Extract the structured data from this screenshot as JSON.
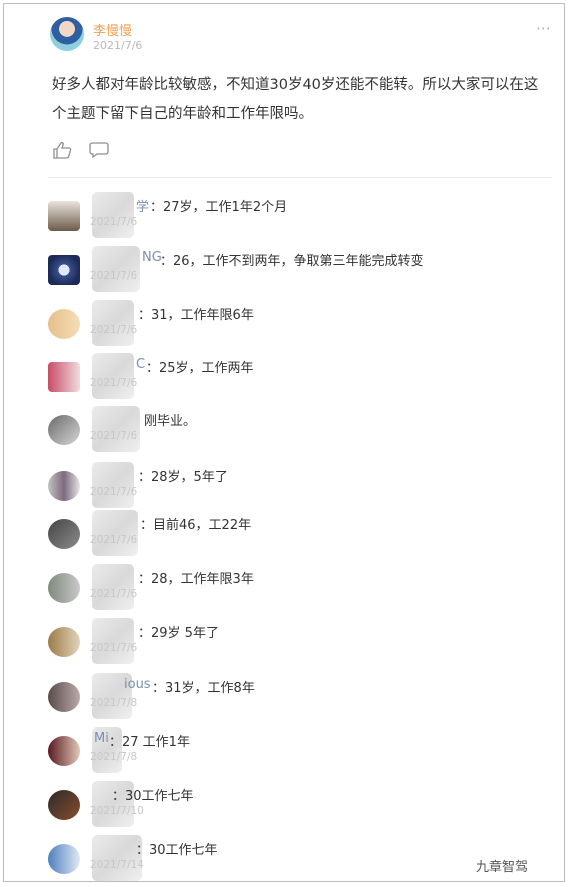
{
  "post": {
    "author": "李慢慢",
    "date": "2021/7/6",
    "content": "好多人都对年龄比较敏感，不知道30岁40岁还能不能转。所以大家可以在这个主题下留下自己的年龄和工作年限吗。",
    "more_icon": "more-icon",
    "like_icon": "like-icon",
    "comment_icon": "comment-icon"
  },
  "comments": [
    {
      "name": "学",
      "text": "：27岁，工作1年2个月",
      "date": "2021/7/6"
    },
    {
      "name": "NG",
      "text": "：26，工作不到两年，争取第三年能完成转变",
      "date": "2021/7/6"
    },
    {
      "name": "",
      "text": "：31，工作年限6年",
      "date": "2021/7/6"
    },
    {
      "name": "C",
      "text": "：25岁，工作两年",
      "date": "2021/7/6"
    },
    {
      "name": "",
      "text": "刚毕业。",
      "date": "2021/7/6"
    },
    {
      "name": "",
      "text": "：28岁，5年了",
      "date": "2021/7/6"
    },
    {
      "name": "",
      "text": "：目前46，工22年",
      "date": "2021/7/6"
    },
    {
      "name": "",
      "text": "：28，工作年限3年",
      "date": "2021/7/6"
    },
    {
      "name": "",
      "text": "：29岁 5年了",
      "date": "2021/7/6"
    },
    {
      "name": "ious",
      "text": "：31岁，工作8年",
      "date": "2021/7/8"
    },
    {
      "name": "Mi",
      "text": "：27 工作1年",
      "date": "2021/7/8"
    },
    {
      "name": "",
      "text": "：30工作七年",
      "date": "2021/7/10"
    },
    {
      "name": "",
      "text": "：30工作七年",
      "date": "2021/7/14"
    }
  ],
  "watermark": "九章智驾",
  "colors": {
    "author": "#f0a052",
    "name": "#7a8fb0",
    "text": "#333333",
    "date": "#c8c8c8"
  }
}
